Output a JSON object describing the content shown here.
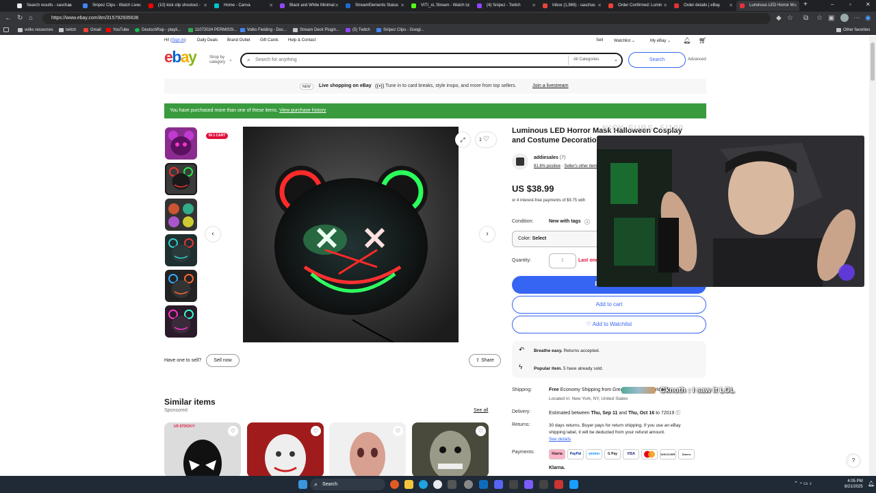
{
  "browser": {
    "tabs": [
      {
        "label": "Search results - saschas",
        "color": "#e8eaed"
      },
      {
        "label": "Snipez Clips - Watch Live",
        "color": "#4285f4"
      },
      {
        "label": "(10) kick clip shoutout -",
        "color": "#ff0000"
      },
      {
        "label": "Home - Canva",
        "color": "#00c4cc"
      },
      {
        "label": "Black and White Minimal",
        "color": "#9146ff"
      },
      {
        "label": "StreamElements Status",
        "color": "#1b6ad3"
      },
      {
        "label": "VITI_xL Stream - Watch Li",
        "color": "#53fc18"
      },
      {
        "label": "(4) Snipez - Twitch",
        "color": "#9146ff"
      },
      {
        "label": "Inbox (1,969) - saschas",
        "color": "#ea4335"
      },
      {
        "label": "Order Confirmed: Lumin",
        "color": "#ea4335"
      },
      {
        "label": "Order details | eBay",
        "color": "#e53238"
      },
      {
        "label": "Luminous LED Horror M",
        "color": "#e53238"
      }
    ],
    "url": "https://www.ebay.com/itm/315792935636",
    "bookmarks": [
      "volks resources",
      "twitch",
      "Gmail",
      "YouTube",
      "DeutschRap - playli...",
      "11072024 PERMISSI...",
      "Volks Fielding - Doc...",
      "Stream Deck Plugin...",
      "(5) Twitch",
      "Snipez Clips - Googl..."
    ],
    "other_favorites": "Other favorites"
  },
  "ebay": {
    "greeting_pre": "Hi!",
    "sign_in": "Sign in",
    "greeting_post": "",
    "topnav": [
      "Daily Deals",
      "Brand Outlet",
      "Gift Cards",
      "Help & Contact"
    ],
    "sell": "Sell",
    "watchlist": "Watchlist",
    "my_ebay": "My eBay",
    "shop_by": "Shop by",
    "category": "category",
    "search_placeholder": "Search for anything",
    "all_categories": "All Categories",
    "search_btn": "Search",
    "advanced": "Advanced",
    "live_badge": "NEW",
    "live_title": "Live shopping on eBay",
    "live_desc": "Tune in to card breaks, style inspo, and more from top sellers.",
    "live_link": "Join a livestream",
    "purchased_msg": "You have purchased more than one of these items.",
    "purchase_link": "View purchase history",
    "in_cart": "IN 1 CART",
    "watch_count": "1",
    "title_line1": "Luminous LED Horror Mask Halloween Cosplay",
    "title_line2": "and Costume Decoration",
    "seller": "addiesales",
    "seller_count": "(7)",
    "positive": "81.8% positive",
    "sellers_other": "Seller's other items",
    "price": "US $38.99",
    "interest": "or 4 interest-free payments of $9.75 with",
    "condition_label": "Condition:",
    "condition_val": "New with tags",
    "color_label": "Color:",
    "color_val": "Select",
    "quantity_label": "Quantity:",
    "quantity_val": "1",
    "last_one": "Last one",
    "buy_now": "Buy It Now",
    "add_cart": "Add to cart",
    "add_watch": "♡ Add to Watchlist",
    "breathe_b": "Breathe easy.",
    "breathe": "Returns accepted.",
    "popular_b": "Popular item.",
    "popular": "5 have already sold.",
    "shipping_label": "Shipping:",
    "shipping_free": "Free",
    "shipping_val": "Economy Shipping from Greater China to worldwide",
    "located": "Located in: New York, NY, United States",
    "delivery_label": "Delivery:",
    "delivery_pre": "Estimated between",
    "delivery_d1": "Thu, Sep 11",
    "delivery_and": "and",
    "delivery_d2": "Thu, Oct 16",
    "delivery_post": "to 72019",
    "returns_label": "Returns:",
    "returns_l1": "30 days returns. Buyer pays for return shipping. If you use an eBay",
    "returns_l2": "shipping label, it will be deducted from your refund amount.",
    "see_details": "See details",
    "payments_label": "Payments:",
    "payments": [
      "Klarna",
      "PayPal",
      "venmo",
      "G Pay",
      "VISA",
      "MC",
      "DISCOVER",
      "Diners"
    ],
    "klarna": "Klarna.",
    "have_one": "Have one to sell?",
    "sell_now": "Sell now",
    "share": "Share",
    "similar": "Similar items",
    "sponsored": "Sponsored",
    "see_all": "See all",
    "sim_badge": "US STOCK!!!"
  },
  "overlay": {
    "kick_subs": "KICK SUBS: 5/100",
    "chat": "Cknoth : I saw it LOL"
  },
  "taskbar": {
    "search": "Search",
    "time": "4:05 PM",
    "date": "8/21/2025"
  }
}
